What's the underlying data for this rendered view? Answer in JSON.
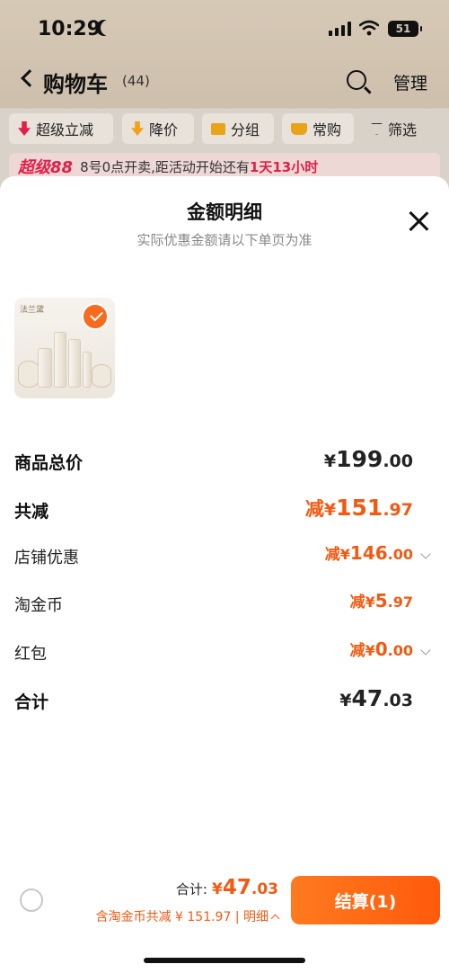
{
  "status_bar": {
    "time": "10:29",
    "battery": "51"
  },
  "nav": {
    "title": "购物车",
    "count": "(44)",
    "manage": "管理"
  },
  "filters": [
    {
      "label": "超级立减",
      "color": "#e0204a"
    },
    {
      "label": "降价",
      "color": "#f2a21a"
    },
    {
      "label": "分组",
      "color": "#e8a317"
    },
    {
      "label": "常购",
      "color": "#e8a317"
    },
    {
      "label": "筛选",
      "color": "#333333"
    }
  ],
  "promo": {
    "logo": "超级88",
    "text": "8号0点开卖,距活动开始还有",
    "countdown": "1天13小时"
  },
  "sheet": {
    "title": "金额明细",
    "subtitle": "实际优惠金额请以下单页为准",
    "product": {
      "brand": "法兰黛",
      "selected": true
    },
    "rows": [
      {
        "label": "商品总价",
        "prefix": "",
        "yen": "¥",
        "int": "199",
        "dec": ".00"
      },
      {
        "label": "共减",
        "prefix": "减",
        "yen": "¥",
        "int": "151",
        "dec": ".97"
      },
      {
        "label": "店铺优惠",
        "prefix": "减",
        "yen": "¥",
        "int": "146",
        "dec": ".00"
      },
      {
        "label": "淘金币",
        "prefix": "减",
        "yen": "¥",
        "int": "5",
        "dec": ".97"
      },
      {
        "label": "红包",
        "prefix": "减",
        "yen": "¥",
        "int": "0",
        "dec": ".00"
      },
      {
        "label": "合计",
        "prefix": "",
        "yen": "¥",
        "int": "47",
        "dec": ".03"
      }
    ]
  },
  "footer": {
    "total_label": "合计:",
    "total_yen": "¥",
    "total_int": "47",
    "total_dec": ".03",
    "savings": "含淘金币共减 ¥ 151.97 | 明细",
    "checkout": "结算(1)"
  },
  "colors": {
    "accent": "#f25a12",
    "checkout": "#ff6a14"
  }
}
